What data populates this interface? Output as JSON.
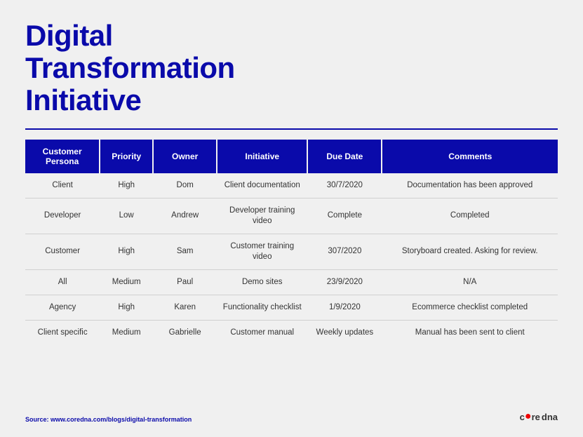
{
  "title": {
    "line1": "Digital",
    "line2": "Transformation",
    "line3": "Initiative"
  },
  "table": {
    "headers": [
      "Customer Persona",
      "Priority",
      "Owner",
      "Initiative",
      "Due Date",
      "Comments"
    ],
    "rows": [
      {
        "persona": "Client",
        "priority": "High",
        "owner": "Dom",
        "initiative": "Client documentation",
        "due_date": "30/7/2020",
        "comments": "Documentation has been approved"
      },
      {
        "persona": "Developer",
        "priority": "Low",
        "owner": "Andrew",
        "initiative": "Developer training video",
        "due_date": "Complete",
        "comments": "Completed"
      },
      {
        "persona": "Customer",
        "priority": "High",
        "owner": "Sam",
        "initiative": "Customer training video",
        "due_date": "307/2020",
        "comments": "Storyboard created. Asking for review."
      },
      {
        "persona": "All",
        "priority": "Medium",
        "owner": "Paul",
        "initiative": "Demo sites",
        "due_date": "23/9/2020",
        "comments": "N/A"
      },
      {
        "persona": "Agency",
        "priority": "High",
        "owner": "Karen",
        "initiative": "Functionality checklist",
        "due_date": "1/9/2020",
        "comments": "Ecommerce checklist completed"
      },
      {
        "persona": "Client specific",
        "priority": "Medium",
        "owner": "Gabrielle",
        "initiative": "Customer manual",
        "due_date": "Weekly updates",
        "comments": "Manual has been sent to client"
      }
    ]
  },
  "footer": {
    "source_text": "Source: www.coredna.com/blogs/digital-transformation",
    "logo_core": "c",
    "logo_dot": "o",
    "logo_rest": "re",
    "logo_dna": "dna",
    "logo_full": "coredna"
  }
}
